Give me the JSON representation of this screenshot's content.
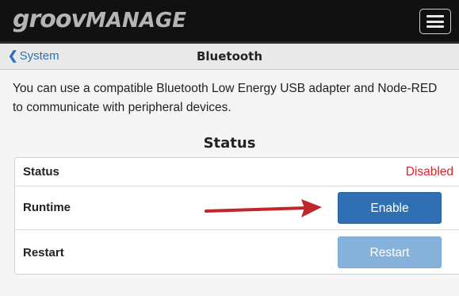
{
  "app": {
    "logo_brand": "groov",
    "logo_product": "MANAGE"
  },
  "header": {
    "menu_icon": "hamburger-menu-icon"
  },
  "nav": {
    "back_label": "System",
    "back_icon": "chevron-left-icon",
    "title": "Bluetooth"
  },
  "description": "You can use a compatible Bluetooth Low Energy USB adapter and Node-RED to communicate with peripheral devices.",
  "status_section": {
    "title": "Status",
    "rows": [
      {
        "label": "Status",
        "value": "Disabled"
      },
      {
        "label": "Runtime",
        "action": "Enable"
      },
      {
        "label": "Restart",
        "action": "Restart",
        "action_disabled": true
      }
    ]
  },
  "annotation": {
    "arrow_icon": "red-arrow-icon",
    "arrow_color": "#c0272d"
  },
  "colors": {
    "header_bg": "#111111",
    "accent_blue": "#2f70b5",
    "disabled_blue": "#85b1db",
    "status_red": "#d9252a"
  }
}
